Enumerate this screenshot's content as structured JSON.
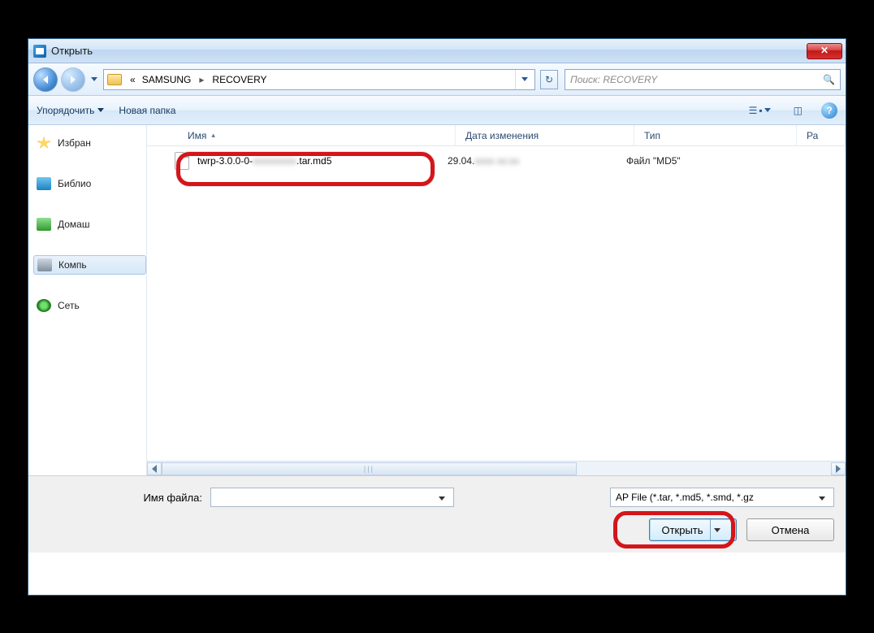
{
  "window": {
    "title": "Открыть"
  },
  "nav": {
    "crumb_prefix": "«",
    "crumb1": "SAMSUNG",
    "crumb2": "RECOVERY",
    "search_placeholder": "Поиск: RECOVERY"
  },
  "toolbar": {
    "organize": "Упорядочить",
    "newfolder": "Новая папка"
  },
  "navpane": {
    "favorites": "Избран",
    "libraries": "Библио",
    "homegroup": "Домаш",
    "computer": "Компь",
    "network": "Сеть"
  },
  "columns": {
    "name": "Имя",
    "date": "Дата изменения",
    "type": "Тип",
    "size": "Ра"
  },
  "files": [
    {
      "name_pre": "twrp-3.0.0-0-",
      "name_blur": "xxxxxxxxx",
      "name_post": ".tar.md5",
      "date_pre": "29.04.",
      "date_blur": "xxxx xx:xx",
      "type": "Файл \"MD5\""
    }
  ],
  "bottom": {
    "filename_label": "Имя файла:",
    "filename_value": "",
    "filter": "AP File (*.tar, *.md5, *.smd, *.gz",
    "open": "Открыть",
    "cancel": "Отмена"
  }
}
